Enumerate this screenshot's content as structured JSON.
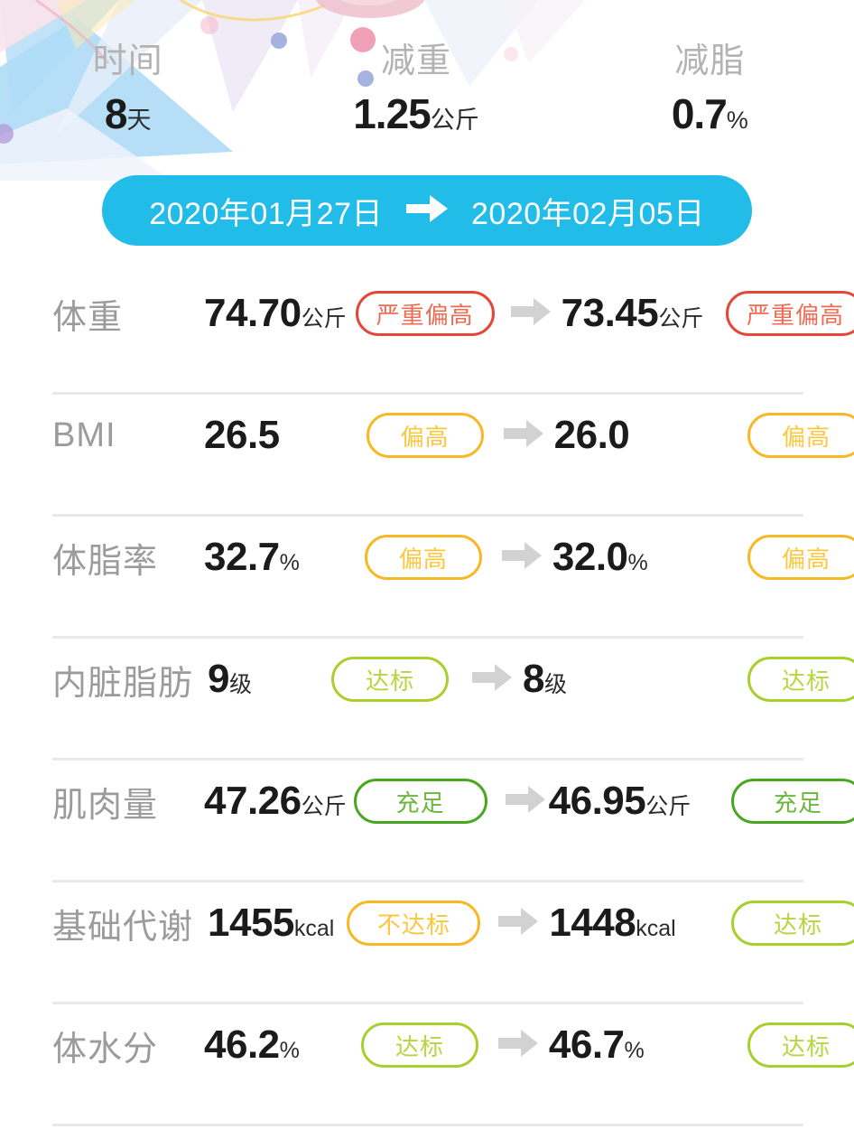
{
  "theme": {
    "accent_cyan": "#22bce8",
    "label_grey": "#9b9b9b",
    "value_black": "#1b1b1b",
    "divider_grey": "#e9e9e9",
    "arrow_grey": "#d2d2d2",
    "status_red": "#e4473a",
    "status_red_text": "#ef6a53",
    "status_orange": "#f7b825",
    "status_orange_text": "#fcc63f",
    "status_lime": "#a8cf2c",
    "status_lime_text": "#b5d641",
    "status_green": "#47a81f",
    "status_green_text": "#6bb73c",
    "dot_periwinkle": "#97a6dc"
  },
  "summary": {
    "stats": [
      {
        "label": "时间",
        "value": "8",
        "unit": "天"
      },
      {
        "label": "减重",
        "value": "1.25",
        "unit": "公斤"
      },
      {
        "label": "减脂",
        "value": "0.7",
        "unit": "%"
      }
    ]
  },
  "date_range": {
    "start": "2020年01月27日",
    "arrow_icon": "arrow-right-icon",
    "end": "2020年02月05日"
  },
  "comparison": {
    "arrow_icon": "arrow-right-icon",
    "rows": [
      {
        "metric": "体重",
        "before": {
          "value": "74.70",
          "unit": "公斤",
          "status": "严重偏高",
          "level": "red"
        },
        "after": {
          "value": "73.45",
          "unit": "公斤",
          "status": "严重偏高",
          "level": "red"
        }
      },
      {
        "metric": "BMI",
        "before": {
          "value": "26.5",
          "unit": "",
          "status": "偏高",
          "level": "orange"
        },
        "after": {
          "value": "26.0",
          "unit": "",
          "status": "偏高",
          "level": "orange"
        }
      },
      {
        "metric": "体脂率",
        "before": {
          "value": "32.7",
          "unit": "%",
          "status": "偏高",
          "level": "orange"
        },
        "after": {
          "value": "32.0",
          "unit": "%",
          "status": "偏高",
          "level": "orange"
        }
      },
      {
        "metric": "内脏脂肪",
        "before": {
          "value": "9",
          "unit": "级",
          "status": "达标",
          "level": "lime"
        },
        "after": {
          "value": "8",
          "unit": "级",
          "status": "达标",
          "level": "lime"
        }
      },
      {
        "metric": "肌肉量",
        "before": {
          "value": "47.26",
          "unit": "公斤",
          "status": "充足",
          "level": "green"
        },
        "after": {
          "value": "46.95",
          "unit": "公斤",
          "status": "充足",
          "level": "green"
        }
      },
      {
        "metric": "基础代谢",
        "before": {
          "value": "1455",
          "unit": "kcal",
          "status": "不达标",
          "level": "orange"
        },
        "after": {
          "value": "1448",
          "unit": "kcal",
          "status": "达标",
          "level": "lime"
        }
      },
      {
        "metric": "体水分",
        "before": {
          "value": "46.2",
          "unit": "%",
          "status": "达标",
          "level": "lime"
        },
        "after": {
          "value": "46.7",
          "unit": "%",
          "status": "达标",
          "level": "lime"
        }
      }
    ]
  }
}
